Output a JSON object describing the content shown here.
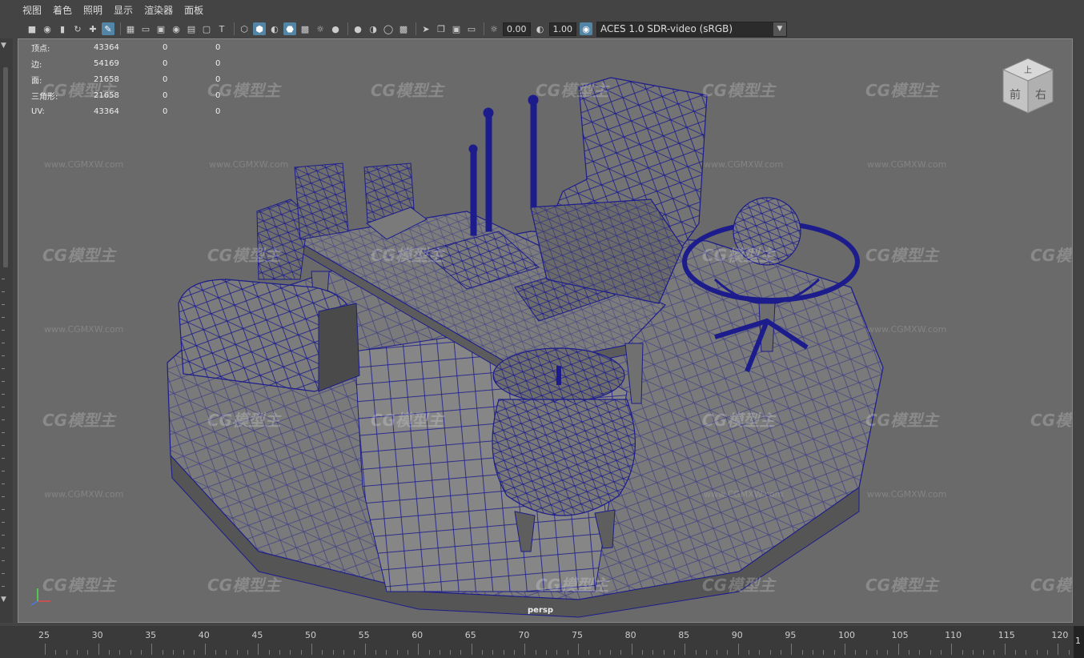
{
  "menu": [
    "视图",
    "着色",
    "照明",
    "显示",
    "渲染器",
    "面板"
  ],
  "toolbar": {
    "exposure_value": "0.00",
    "gamma_value": "1.00",
    "color_space": "ACES 1.0 SDR-video (sRGB)"
  },
  "hud": {
    "rows": [
      {
        "label": "顶点:",
        "v1": "43364",
        "v2": "0",
        "v3": "0"
      },
      {
        "label": "边:",
        "v1": "54169",
        "v2": "0",
        "v3": "0"
      },
      {
        "label": "面:",
        "v1": "21658",
        "v2": "0",
        "v3": "0"
      },
      {
        "label": "三角形:",
        "v1": "21658",
        "v2": "0",
        "v3": "0"
      },
      {
        "label": "UV:",
        "v1": "43364",
        "v2": "0",
        "v3": "0"
      }
    ]
  },
  "view_cube": {
    "top": "上",
    "front": "前",
    "right": "右"
  },
  "camera_label": "persp",
  "watermark": {
    "brand": "CG模型主",
    "url": "www.CGMXW.com"
  },
  "timeline": {
    "ticks": [
      "25",
      "30",
      "35",
      "40",
      "45",
      "50",
      "55",
      "60",
      "65",
      "70",
      "75",
      "80",
      "85",
      "90",
      "95",
      "100",
      "105",
      "110",
      "115",
      "120"
    ],
    "current": "1"
  },
  "colors": {
    "wireframe": "#1c1c8c",
    "viewport_bg": "#6a6a6a",
    "accent": "#5285a6"
  }
}
